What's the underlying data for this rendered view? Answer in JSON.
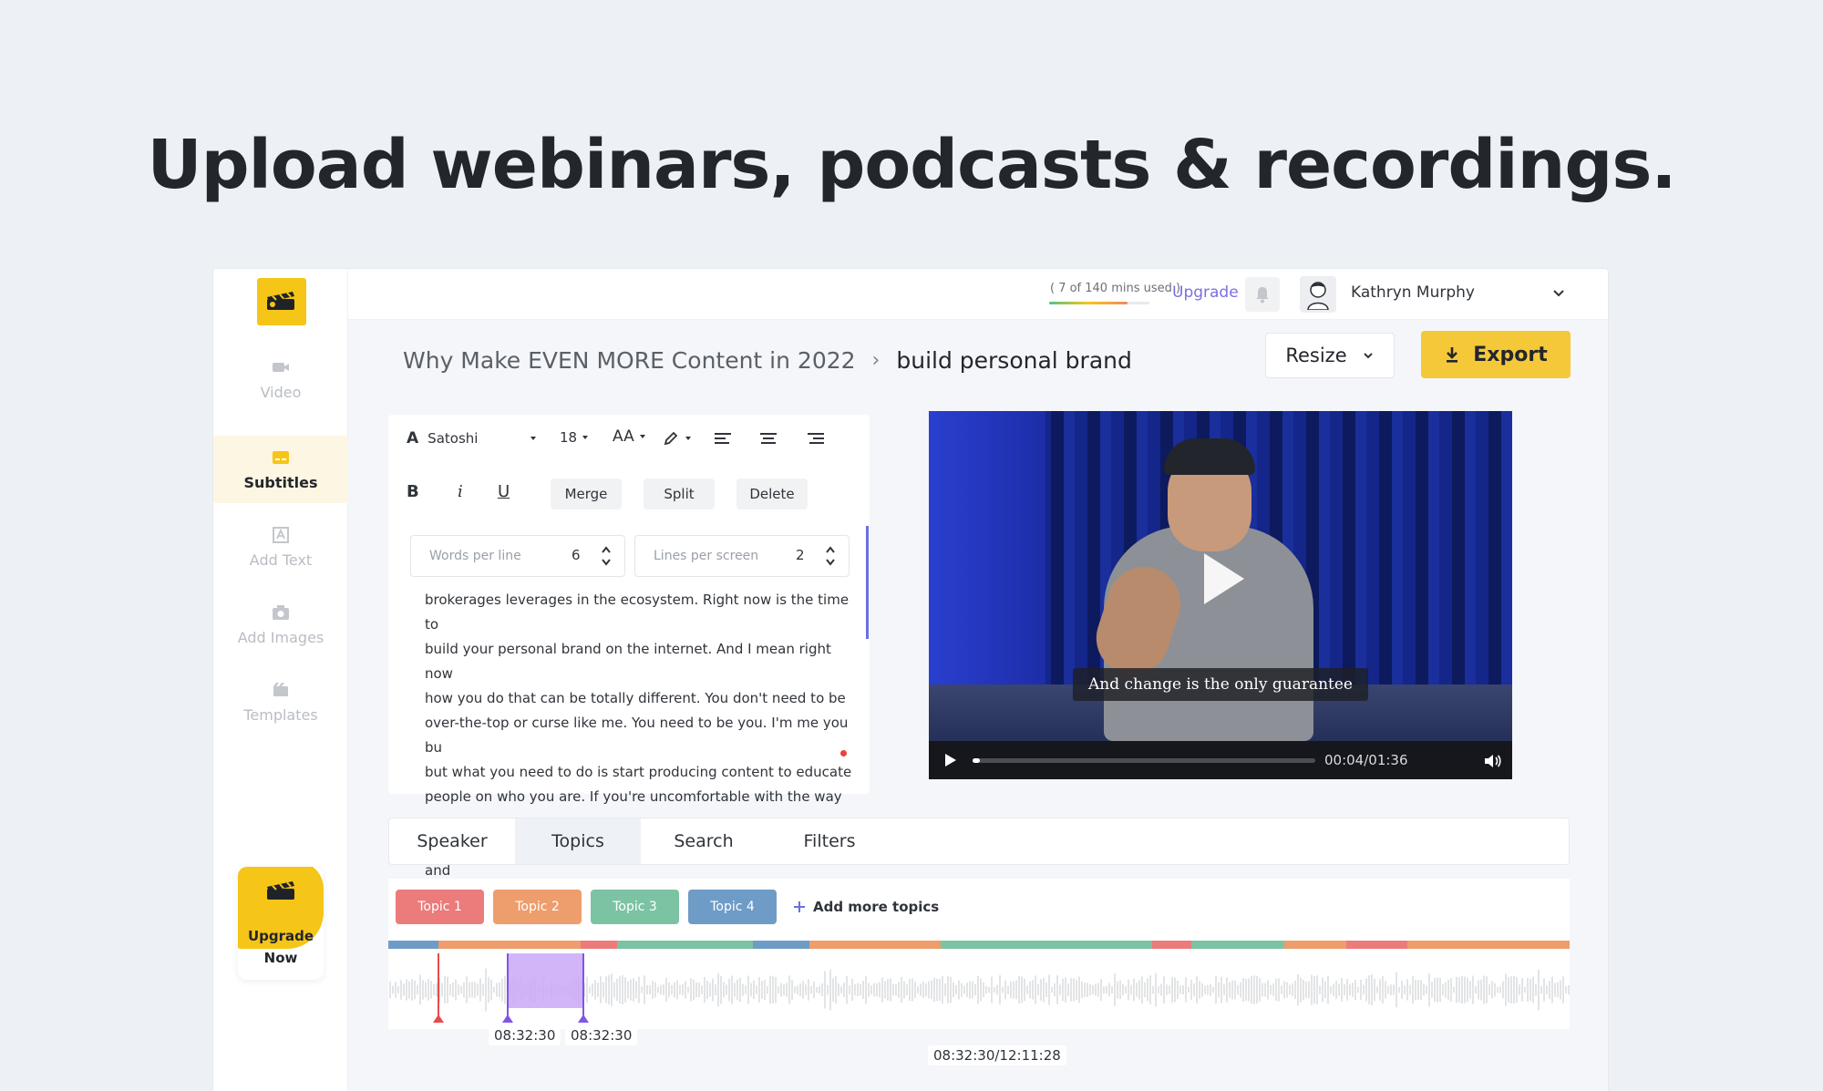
{
  "headline": "Upload webinars, podcasts & recordings.",
  "sidebar": {
    "items": [
      {
        "label": "Video",
        "icon": "video-camera-icon"
      },
      {
        "label": "Subtitles",
        "icon": "subtitles-icon",
        "active": true
      },
      {
        "label": "Add Text",
        "icon": "add-text-icon"
      },
      {
        "label": "Add Images",
        "icon": "camera-icon"
      },
      {
        "label": "Templates",
        "icon": "templates-icon"
      }
    ],
    "upgrade_line1": "Upgrade",
    "upgrade_line2": "Now"
  },
  "topbar": {
    "minutes_used": "( 7 of 140 mins used )",
    "upgrade_link": "Upgrade",
    "user_name": "Kathryn Murphy"
  },
  "breadcrumb": {
    "project": "Why Make EVEN MORE Content in 2022",
    "separator": "›",
    "current": "build personal brand"
  },
  "actions": {
    "resize_label": "Resize",
    "export_label": "Export"
  },
  "editor": {
    "font_name": "Satoshi",
    "font_size": "18",
    "case_label": "AA",
    "bold_label": "B",
    "italic_label": "i",
    "underline_label": "U",
    "merge_label": "Merge",
    "split_label": "Split",
    "delete_label": "Delete",
    "words_per_line_label": "Words per line",
    "words_per_line_value": "6",
    "lines_per_screen_label": "Lines per screen",
    "lines_per_screen_value": "2",
    "transcript": "brokerages leverages in the ecosystem. Right now is the time to\nbuild your personal brand on the internet. And I mean right now\nhow you do that can be totally different. You don't need to be\nover-the-top or curse like me. You need to be you. I'm me you bu\nbut what you need to do is start producing content to educate\npeople on who you are. If you're uncomfortable with the way you\nlook and you want, don't want to be on video, then do audio and"
  },
  "video": {
    "caption": "And change is the only guarantee",
    "time": "00:04/01:36",
    "progress": 0.02
  },
  "tabs": [
    {
      "label": "Speaker"
    },
    {
      "label": "Topics",
      "active": true
    },
    {
      "label": "Search"
    },
    {
      "label": "Filters"
    }
  ],
  "timeline": {
    "topics": [
      {
        "label": "Topic 1",
        "color": "#ec7b7b"
      },
      {
        "label": "Topic 2",
        "color": "#ee9d6c"
      },
      {
        "label": "Topic 3",
        "color": "#7cc3a3"
      },
      {
        "label": "Topic 4",
        "color": "#6e9cc7"
      }
    ],
    "add_topics_label": "Add more topics",
    "selection_start": "08:32:30",
    "selection_end": "08:32:30",
    "position": "08:32:30/12:11:28"
  },
  "colors": {
    "accent_yellow": "#f5c83a",
    "upgrade_purple": "#7b6fe0"
  }
}
